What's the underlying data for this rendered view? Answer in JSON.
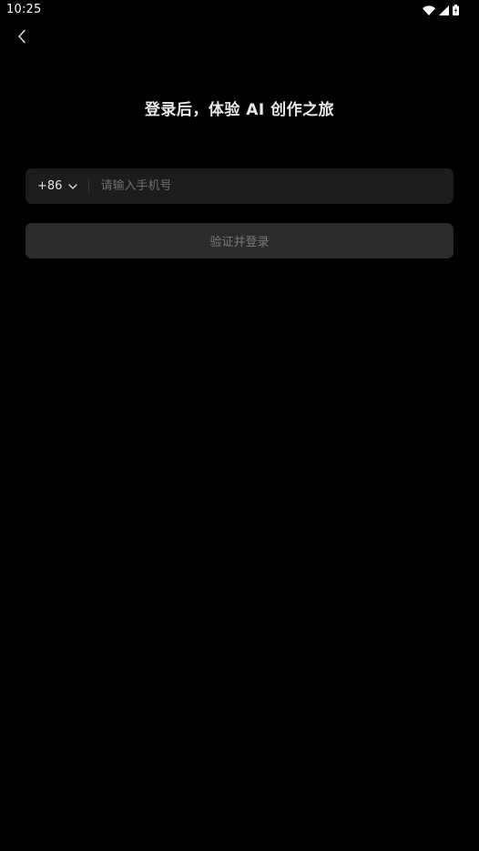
{
  "status_bar": {
    "time": "10:25",
    "icons": [
      "wifi-icon",
      "signal-icon",
      "battery-icon"
    ]
  },
  "header": {
    "back_icon": "chevron-left-icon"
  },
  "main": {
    "title": "登录后，体验 AI 创作之旅",
    "phone": {
      "country_code": "+86",
      "placeholder": "请输入手机号",
      "value": ""
    },
    "submit_label": "验证并登录"
  },
  "colors": {
    "background": "#000000",
    "input_bg": "#1c1c1e",
    "button_bg_disabled": "#2b2b2d",
    "button_text_disabled": "#7a7a7d",
    "placeholder": "#6f6f73"
  }
}
